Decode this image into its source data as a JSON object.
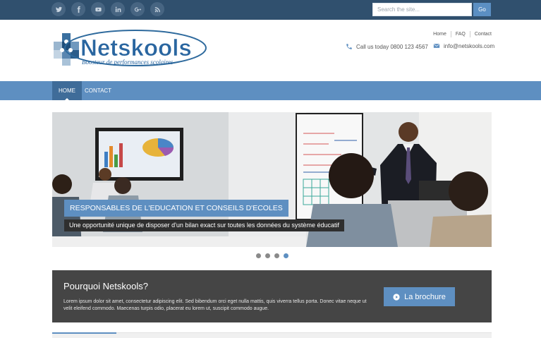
{
  "social": [
    {
      "name": "twitter-icon"
    },
    {
      "name": "facebook-icon"
    },
    {
      "name": "youtube-icon"
    },
    {
      "name": "linkedin-icon"
    },
    {
      "name": "googleplus-icon"
    },
    {
      "name": "rss-icon"
    }
  ],
  "search": {
    "placeholder": "Search the site...",
    "button": "Go"
  },
  "logo": {
    "name": "Netskools",
    "tagline": "Boosteur de performances scolaires"
  },
  "top_links": [
    "Home",
    "FAQ",
    "Contact"
  ],
  "contact": {
    "phone": "Call us today 0800 123 4567",
    "email": "info@netskools.com"
  },
  "nav": {
    "home": "Home",
    "contact": "Contact"
  },
  "slider": {
    "title": "RESPONSABLES DE L'EDUCATION ET CONSEILS D'ECOLES",
    "subtitle": "Une opportunité unique de disposer d'un bilan exact sur toutes les données du système éducatif",
    "dots": 4,
    "active_dot": 3
  },
  "why": {
    "title": "Pourquoi Netskools?",
    "text": "Lorem ipsum dolor sit amet, consectetur adipiscing elit. Sed bibendum orci eget nulla mattis, quis viverra tellus porta. Donec vitae neque ut velit eleifend commodo. Maecenas turpis odio, placerat eu lorem ut, suscipit commodo augue.",
    "button": "La brochure"
  },
  "colors": {
    "topbar": "#30506e",
    "accent": "#5e8fc1",
    "nav_active": "#3f6c99",
    "panel": "#454545"
  }
}
